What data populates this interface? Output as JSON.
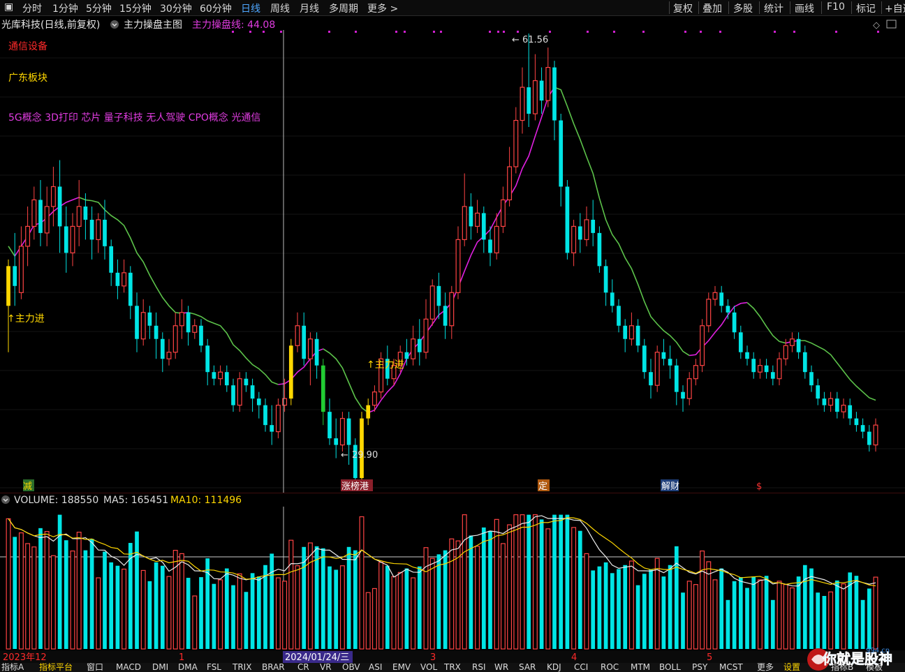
{
  "toolbar": {
    "periods": [
      "分时",
      "1分钟",
      "5分钟",
      "15分钟",
      "30分钟",
      "60分钟",
      "日线",
      "周线",
      "月线",
      "多周期",
      "更多 >"
    ],
    "active_period": "日线",
    "right_buttons": [
      "复权",
      "叠加",
      "多股",
      "统计",
      "画线",
      "F10",
      "标记",
      "+自选"
    ]
  },
  "header": {
    "stock": "光库科技(日线,前复权)",
    "indicator": "主力操盘主图",
    "line_label": "主力操盘线: 44.08"
  },
  "tags": {
    "industry": "通信设备",
    "region": "广东板块",
    "concepts": "5G概念 3D打印 芯片 量子科技 无人驾驶 CPO概念 光通信"
  },
  "signals": [
    "↑主力进",
    "↑主力进"
  ],
  "price_marks": {
    "high": "61.56",
    "low": "29.90"
  },
  "event_marks": [
    "减",
    "涨榜港",
    "定",
    "解财",
    "$"
  ],
  "volume_header": {
    "volume": "VOLUME: 188550",
    "ma5": "MA5: 165451",
    "ma10": "MA10: 111496"
  },
  "axis_dates": [
    "2023年12",
    "1",
    "2024/01/24/三",
    "3",
    "4",
    "5"
  ],
  "bottom_tabs": [
    "指标A",
    "指标平台",
    "窗口",
    "MACD",
    "DMI",
    "DMA",
    "FSL",
    "TRIX",
    "BRAR",
    "CR",
    "VR",
    "OBV",
    "ASI",
    "EMV",
    "VOL",
    "TRX",
    "RSI",
    "WR",
    "SAR",
    "KDJ",
    "CCI",
    "ROC",
    "MTM",
    "BOLL",
    "PSY",
    "MCST",
    "更多",
    "设置",
    "指标B",
    "模板"
  ],
  "watermark": {
    "text": "你就是股神",
    "url": "994.cn"
  },
  "colors": {
    "up": "#ff4444",
    "down": "#00e5e5",
    "ma_green": "#5cc24a",
    "ma_magenta": "#e020e0",
    "signal": "#ffd700",
    "text_red": "#ff2a2a",
    "text_magenta": "#e03ce0"
  },
  "chart_data": [
    {
      "type": "candlestick",
      "title": "光库科技(日线,前复权)",
      "series": [
        {
          "name": "主力操盘线",
          "last": 44.08
        }
      ],
      "annotations": [
        {
          "text": "61.56",
          "kind": "high"
        },
        {
          "text": "29.90",
          "kind": "low"
        }
      ],
      "candles": [
        [
          41.0,
          44.0,
          37.5,
          44.5
        ],
        [
          44.0,
          42.5,
          41.0,
          46.5
        ],
        [
          42.0,
          45.5,
          41.5,
          47.0
        ],
        [
          45.5,
          47.0,
          44.0,
          48.5
        ],
        [
          47.0,
          49.0,
          46.0,
          50.0
        ],
        [
          49.0,
          46.5,
          45.5,
          50.5
        ],
        [
          46.5,
          48.5,
          45.5,
          50.0
        ],
        [
          48.5,
          50.0,
          47.0,
          51.5
        ],
        [
          50.0,
          47.0,
          45.0,
          52.0
        ],
        [
          47.0,
          45.0,
          43.5,
          48.5
        ],
        [
          45.0,
          47.0,
          44.0,
          48.0
        ],
        [
          47.0,
          48.5,
          45.5,
          50.5
        ],
        [
          48.5,
          47.5,
          46.0,
          49.5
        ],
        [
          47.5,
          46.0,
          44.5,
          48.5
        ],
        [
          46.0,
          47.5,
          45.0,
          48.0
        ],
        [
          47.5,
          45.5,
          44.5,
          49.0
        ],
        [
          45.5,
          43.5,
          42.5,
          46.0
        ],
        [
          43.5,
          42.5,
          41.5,
          44.5
        ],
        [
          42.5,
          43.5,
          42.0,
          44.5
        ],
        [
          43.5,
          41.0,
          40.0,
          44.0
        ],
        [
          41.0,
          38.5,
          37.5,
          42.0
        ],
        [
          38.5,
          40.5,
          38.0,
          41.5
        ],
        [
          40.5,
          39.5,
          38.5,
          41.0
        ],
        [
          39.5,
          38.5,
          37.0,
          40.5
        ],
        [
          38.5,
          37.0,
          36.0,
          39.0
        ],
        [
          37.0,
          37.5,
          36.5,
          38.5
        ],
        [
          37.5,
          39.5,
          37.0,
          40.5
        ],
        [
          39.5,
          40.5,
          38.5,
          41.5
        ],
        [
          40.5,
          39.0,
          38.0,
          41.0
        ],
        [
          39.0,
          39.5,
          38.5,
          40.0
        ],
        [
          39.5,
          38.0,
          37.5,
          40.0
        ],
        [
          38.0,
          36.0,
          35.0,
          38.5
        ],
        [
          36.0,
          35.5,
          35.0,
          36.5
        ],
        [
          35.5,
          36.0,
          35.0,
          36.5
        ],
        [
          36.0,
          35.0,
          34.5,
          36.5
        ],
        [
          35.0,
          33.5,
          33.0,
          35.5
        ],
        [
          33.5,
          35.5,
          33.0,
          36.0
        ],
        [
          35.5,
          35.0,
          34.5,
          36.0
        ],
        [
          35.0,
          34.0,
          33.0,
          35.5
        ],
        [
          34.0,
          33.5,
          32.5,
          34.5
        ],
        [
          33.5,
          32.0,
          31.5,
          34.0
        ],
        [
          32.0,
          31.5,
          30.5,
          33.5
        ],
        [
          31.5,
          33.5,
          31.0,
          34.0
        ],
        [
          33.5,
          34.0,
          33.0,
          35.5
        ],
        [
          34.0,
          38.0,
          33.5,
          38.5
        ],
        [
          38.0,
          39.5,
          37.5,
          40.5
        ],
        [
          39.5,
          37.0,
          36.5,
          40.5
        ],
        [
          37.0,
          38.5,
          35.0,
          39.0
        ],
        [
          38.5,
          36.5,
          35.5,
          39.0
        ],
        [
          36.5,
          33.0,
          32.0,
          37.0
        ],
        [
          33.0,
          31.0,
          30.5,
          34.0
        ],
        [
          31.0,
          30.5,
          29.5,
          32.5
        ],
        [
          30.5,
          32.5,
          30.0,
          33.0
        ],
        [
          32.5,
          30.5,
          29.0,
          33.0
        ],
        [
          30.5,
          28.0,
          27.5,
          31.0
        ],
        [
          28.0,
          32.5,
          27.5,
          33.0
        ],
        [
          32.5,
          33.5,
          32.0,
          34.0
        ],
        [
          33.5,
          34.5,
          33.0,
          35.0
        ],
        [
          34.5,
          37.0,
          34.0,
          37.5
        ],
        [
          37.0,
          35.5,
          35.0,
          38.0
        ],
        [
          35.5,
          36.5,
          35.0,
          37.0
        ],
        [
          36.5,
          37.5,
          36.0,
          38.0
        ],
        [
          37.5,
          37.0,
          36.5,
          38.5
        ],
        [
          37.0,
          38.5,
          36.5,
          39.5
        ],
        [
          38.5,
          37.5,
          36.5,
          40.0
        ],
        [
          37.5,
          40.0,
          37.0,
          41.5
        ],
        [
          40.0,
          42.5,
          39.5,
          43.0
        ],
        [
          42.5,
          41.0,
          40.0,
          43.5
        ],
        [
          41.0,
          39.5,
          38.5,
          42.0
        ],
        [
          39.5,
          42.0,
          38.5,
          42.5
        ],
        [
          42.0,
          46.0,
          41.5,
          47.0
        ],
        [
          46.0,
          48.5,
          45.5,
          51.0
        ],
        [
          48.5,
          47.0,
          46.0,
          49.5
        ],
        [
          47.0,
          48.0,
          46.5,
          49.0
        ],
        [
          48.0,
          46.0,
          45.0,
          48.5
        ],
        [
          46.0,
          45.0,
          44.0,
          47.0
        ],
        [
          45.0,
          47.0,
          44.5,
          48.0
        ],
        [
          47.0,
          49.0,
          46.5,
          50.0
        ],
        [
          49.0,
          51.5,
          48.5,
          53.0
        ],
        [
          51.5,
          55.0,
          51.0,
          56.0
        ],
        [
          55.0,
          57.5,
          54.0,
          59.0
        ],
        [
          57.5,
          55.5,
          54.5,
          61.56
        ],
        [
          55.5,
          58.0,
          55.0,
          60.0
        ],
        [
          58.0,
          56.5,
          55.5,
          59.0
        ],
        [
          56.5,
          59.0,
          56.0,
          60.5
        ],
        [
          59.0,
          55.0,
          53.5,
          59.5
        ],
        [
          55.0,
          50.0,
          48.5,
          55.5
        ],
        [
          50.0,
          45.0,
          44.5,
          50.5
        ],
        [
          45.0,
          47.0,
          44.0,
          47.5
        ],
        [
          47.0,
          46.0,
          45.0,
          48.0
        ],
        [
          46.0,
          47.5,
          45.5,
          48.5
        ],
        [
          47.5,
          46.5,
          45.5,
          49.0
        ],
        [
          46.5,
          44.0,
          43.5,
          47.0
        ],
        [
          44.0,
          42.0,
          41.0,
          44.5
        ],
        [
          42.0,
          41.0,
          40.5,
          43.0
        ],
        [
          41.0,
          39.5,
          39.0,
          41.5
        ],
        [
          39.5,
          38.5,
          37.5,
          40.0
        ],
        [
          38.5,
          39.5,
          38.0,
          40.5
        ],
        [
          39.5,
          38.0,
          37.5,
          40.0
        ],
        [
          38.0,
          36.0,
          35.5,
          38.5
        ],
        [
          36.0,
          35.0,
          34.0,
          37.0
        ],
        [
          35.0,
          37.5,
          34.5,
          38.0
        ],
        [
          37.5,
          37.0,
          36.5,
          38.5
        ],
        [
          37.0,
          36.5,
          35.5,
          38.0
        ],
        [
          36.5,
          34.5,
          33.5,
          37.0
        ],
        [
          34.5,
          34.0,
          33.0,
          35.0
        ],
        [
          34.0,
          35.5,
          33.5,
          36.0
        ],
        [
          35.5,
          36.5,
          35.0,
          37.0
        ],
        [
          36.5,
          39.5,
          36.0,
          40.0
        ],
        [
          39.5,
          41.5,
          39.0,
          42.0
        ],
        [
          41.5,
          42.0,
          41.0,
          42.5
        ],
        [
          42.0,
          41.0,
          40.5,
          42.5
        ],
        [
          41.0,
          40.5,
          40.0,
          41.5
        ],
        [
          40.5,
          39.0,
          38.5,
          41.0
        ],
        [
          39.0,
          37.5,
          37.0,
          39.5
        ],
        [
          37.5,
          37.0,
          36.5,
          38.0
        ],
        [
          37.0,
          36.0,
          35.5,
          37.5
        ],
        [
          36.0,
          36.5,
          35.5,
          37.0
        ],
        [
          36.5,
          36.0,
          35.5,
          37.0
        ],
        [
          36.0,
          35.5,
          35.0,
          36.5
        ],
        [
          35.5,
          37.0,
          35.0,
          37.5
        ],
        [
          37.0,
          38.0,
          36.5,
          38.5
        ],
        [
          38.0,
          38.5,
          37.5,
          39.0
        ],
        [
          38.5,
          37.5,
          37.0,
          39.0
        ],
        [
          37.5,
          36.0,
          35.5,
          38.0
        ],
        [
          36.0,
          35.0,
          34.5,
          36.5
        ],
        [
          35.0,
          34.0,
          33.5,
          35.5
        ],
        [
          34.0,
          33.5,
          33.0,
          34.5
        ],
        [
          33.5,
          34.0,
          33.0,
          34.5
        ],
        [
          34.0,
          33.0,
          32.5,
          34.5
        ],
        [
          33.0,
          33.5,
          32.5,
          34.0
        ],
        [
          33.5,
          32.5,
          32.0,
          34.0
        ],
        [
          32.5,
          32.0,
          31.5,
          33.0
        ],
        [
          32.0,
          31.5,
          31.0,
          32.5
        ],
        [
          31.5,
          30.5,
          30.0,
          32.0
        ],
        [
          30.5,
          32.0,
          30.0,
          32.5
        ]
      ]
    },
    {
      "type": "bar",
      "title": "VOLUME: 188550",
      "series": [
        {
          "name": "VOLUME",
          "last": 188550
        },
        {
          "name": "MA5",
          "last": 165451
        },
        {
          "name": "MA10",
          "last": 111496
        }
      ]
    }
  ]
}
